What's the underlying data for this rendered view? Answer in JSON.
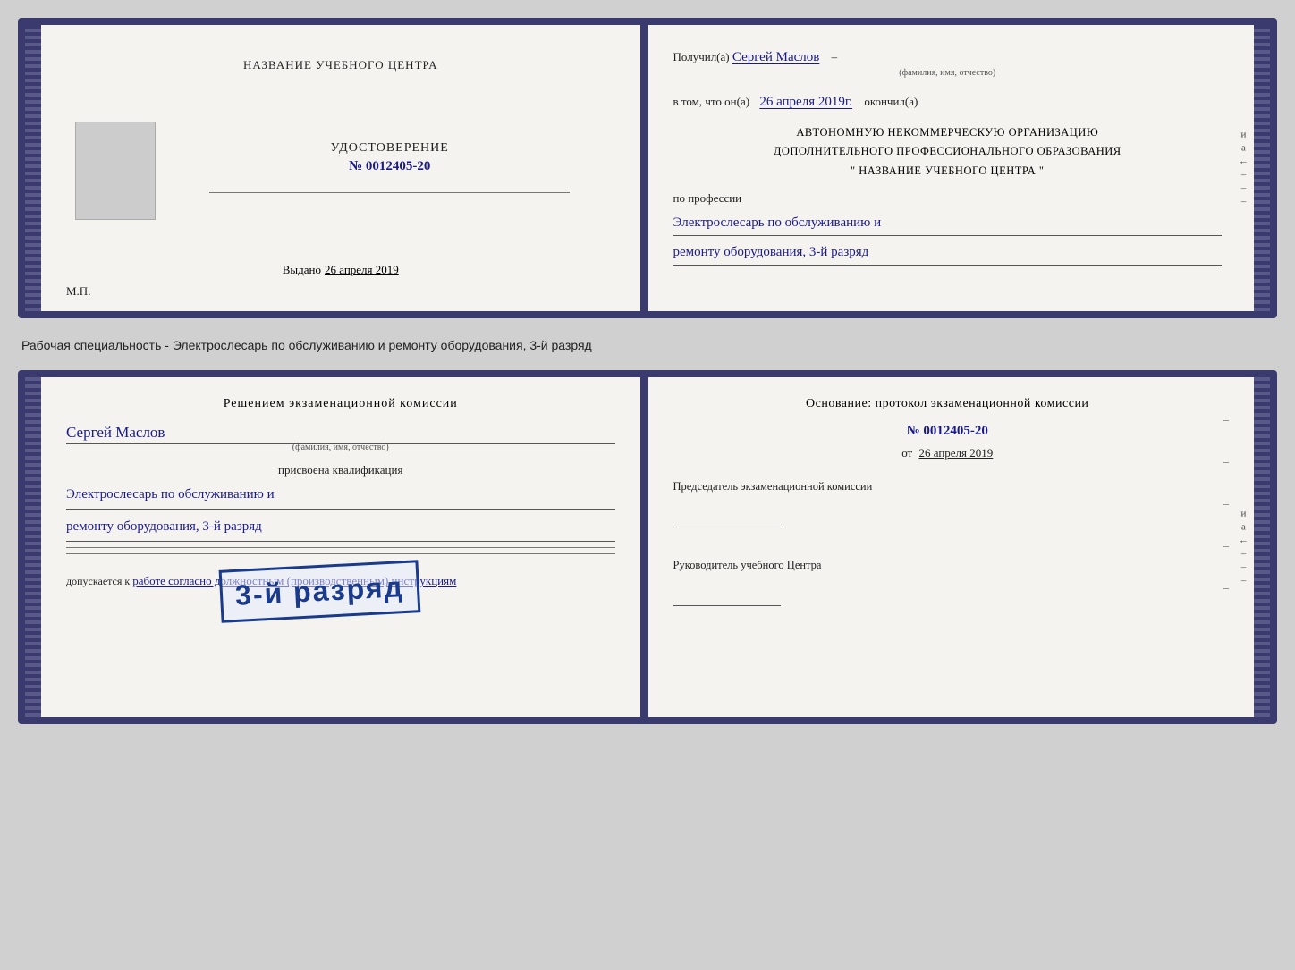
{
  "top_card": {
    "left": {
      "center_title": "НАЗВАНИЕ УЧЕБНОГО ЦЕНТРА",
      "udostoverenie": "УДОСТОВЕРЕНИЕ",
      "number": "№ 0012405-20",
      "vydano_label": "Выдано",
      "vydano_date": "26 апреля 2019",
      "mp_label": "М.П."
    },
    "right": {
      "poluchil_label": "Получил(а)",
      "recipient_name": "Сергей Маслов",
      "fio_label": "(фамилия, имя, отчество)",
      "vtom_label": "в том, что он(а)",
      "date_completed": "26 апреля 2019г.",
      "okonchil_label": "окончил(а)",
      "org_line1": "АВТОНОМНУЮ НЕКОММЕРЧЕСКУЮ ОРГАНИЗАЦИЮ",
      "org_line2": "ДОПОЛНИТЕЛЬНОГО ПРОФЕССИОНАЛЬНОГО ОБРАЗОВАНИЯ",
      "org_name_wrapper": "\"   НАЗВАНИЕ УЧЕБНОГО ЦЕНТРА   \"",
      "po_professii_label": "по профессии",
      "profession_line1": "Электрослесарь по обслуживанию и",
      "profession_line2": "ремонту оборудования, 3-й разряд",
      "right_strip_chars": [
        "и",
        "а",
        "←",
        "–",
        "–",
        "–"
      ]
    }
  },
  "between_label": "Рабочая специальность - Электрослесарь по обслуживанию и ремонту оборудования, 3-й разряд",
  "bottom_card": {
    "left": {
      "resheniem_title": "Решением экзаменационной комиссии",
      "person_name": "Сергей Маслов",
      "fio_label": "(фамилия, имя, отчество)",
      "prisvoena_label": "присвоена квалификация",
      "qualification_line1": "Электрослесарь по обслуживанию и",
      "qualification_line2": "ремонту оборудования, 3-й разряд",
      "dopuskaetsya_label": "допускается к",
      "dopuskaetsya_text": "работе согласно должностным (производственным) инструкциям"
    },
    "right": {
      "osnov_label": "Основание: протокол экзаменационной комиссии",
      "protocol_number": "№  0012405-20",
      "ot_label": "от",
      "protocol_date": "26 апреля 2019",
      "predsedatel_label": "Председатель экзаменационной комиссии",
      "rukovoditel_label": "Руководитель учебного Центра",
      "right_strip_chars": [
        "и",
        "а",
        "←",
        "–",
        "–",
        "–"
      ]
    },
    "stamp": {
      "text": "3-й разряд"
    }
  }
}
